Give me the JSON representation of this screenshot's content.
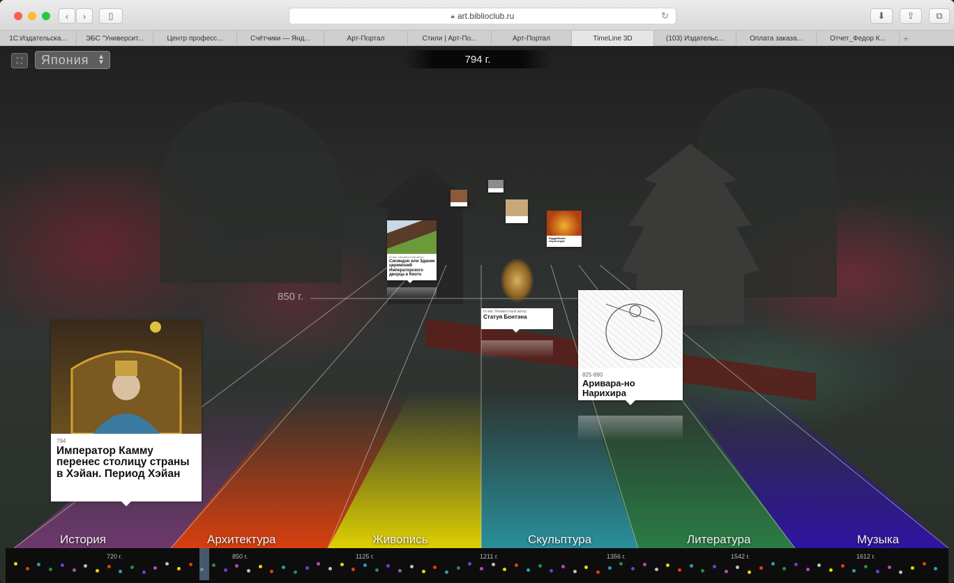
{
  "browser": {
    "url": "art.biblioclub.ru",
    "tabs": [
      {
        "label": "1С:Издательска...",
        "w": 110
      },
      {
        "label": "ЭБС \"Университ...",
        "w": 110
      },
      {
        "label": "Центр професс...",
        "w": 120
      },
      {
        "label": "Счётчики — Янд...",
        "w": 125
      },
      {
        "label": "Арт-Портал",
        "w": 120
      },
      {
        "label": "Стили | Арт-По...",
        "w": 120
      },
      {
        "label": "Арт-Портал",
        "w": 115
      },
      {
        "label": "TimeLine 3D",
        "w": 118,
        "active": true
      },
      {
        "label": "(103) Издательс...",
        "w": 118
      },
      {
        "label": "Оплата заказа...",
        "w": 115
      },
      {
        "label": "Отчет_Федор К...",
        "w": 119
      }
    ]
  },
  "app": {
    "country": "Япония",
    "current_year": "794 г.",
    "depth_label": "850 г.",
    "categories": [
      {
        "label": "История",
        "color": "#7a3a7a"
      },
      {
        "label": "Архитектура",
        "color": "#e0400e"
      },
      {
        "label": "Живопись",
        "color": "#e8d800"
      },
      {
        "label": "Скульптура",
        "color": "#2aa0b0"
      },
      {
        "label": "Литература",
        "color": "#2a8a4a"
      },
      {
        "label": "Музыка",
        "color": "#3010b0"
      }
    ],
    "cards": {
      "main": {
        "year": "794",
        "title": "Император Камму перенес столицу страны в Хэйан. Период Хэйан"
      },
      "ariwara": {
        "year": "825-880",
        "title": "Аривара-но Нарихира"
      },
      "bontain": {
        "year": "IX век. Неизвестный автор",
        "title": "Статуя Бонтэна"
      },
      "shishinden": {
        "year": "IX век. Неизвестный автор",
        "title": "Сисиндэн или Здание церемоний Императорского дворца в Киото"
      },
      "buddha": {
        "year": "",
        "title": "Буддийская скульптура"
      }
    },
    "timeline_ticks": [
      "720 г.",
      "850 г.",
      "1125 г.",
      "1211 г.",
      "1356 г.",
      "1542 г.",
      "1612 г."
    ]
  }
}
